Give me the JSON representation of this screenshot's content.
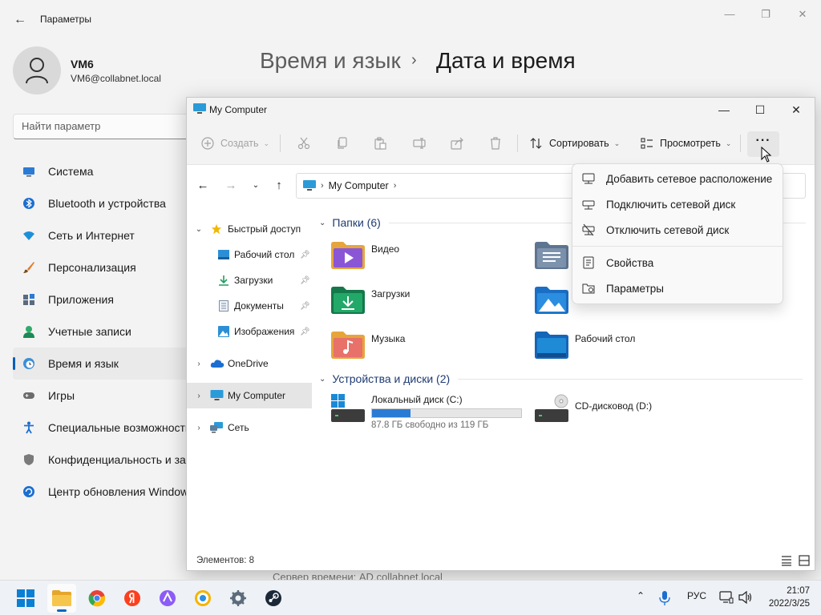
{
  "settings": {
    "window_title": "Параметры",
    "user_name": "VM6",
    "user_email": "VM6@collabnet.local",
    "search_placeholder": "Найти параметр",
    "breadcrumb_parent": "Время и язык",
    "breadcrumb_separator": "›",
    "breadcrumb_current": "Дата и время",
    "bottom_text": "Сервер времени: AD.collabnet.local",
    "nav": [
      {
        "label": "Система",
        "icon": "monitor-icon"
      },
      {
        "label": "Bluetooth и устройства",
        "icon": "bluetooth-icon"
      },
      {
        "label": "Сеть и Интернет",
        "icon": "wifi-icon"
      },
      {
        "label": "Персонализация",
        "icon": "brush-icon"
      },
      {
        "label": "Приложения",
        "icon": "apps-icon"
      },
      {
        "label": "Учетные записи",
        "icon": "person-icon"
      },
      {
        "label": "Время и язык",
        "icon": "globe-clock-icon",
        "active": true
      },
      {
        "label": "Игры",
        "icon": "gamepad-icon"
      },
      {
        "label": "Специальные возможности",
        "icon": "accessibility-icon"
      },
      {
        "label": "Конфиденциальность и защита",
        "icon": "shield-icon"
      },
      {
        "label": "Центр обновления Windows",
        "icon": "update-icon"
      }
    ]
  },
  "explorer": {
    "title": "My Computer",
    "toolbar": {
      "create": "Создать",
      "sort": "Сортировать",
      "view": "Просмотреть",
      "more": "···"
    },
    "address": {
      "location": "My Computer",
      "chevron": "›"
    },
    "tree": [
      {
        "label": "Быстрый доступ",
        "expander": "⌄",
        "icon": "star-icon"
      },
      {
        "label": "Рабочий стол",
        "icon": "desktop-icon",
        "pinned": true
      },
      {
        "label": "Загрузки",
        "icon": "download-icon",
        "pinned": true
      },
      {
        "label": "Документы",
        "icon": "document-icon",
        "pinned": true
      },
      {
        "label": "Изображения",
        "icon": "pictures-icon",
        "pinned": true
      },
      {
        "label": "OneDrive",
        "expander": "›",
        "icon": "cloud-icon"
      },
      {
        "label": "My Computer",
        "expander": "›",
        "icon": "computer-icon",
        "selected": true
      },
      {
        "label": "Сеть",
        "expander": "›",
        "icon": "network-icon"
      }
    ],
    "folders_header": "Папки (6)",
    "folders": [
      {
        "name": "Видео",
        "icon": "video-folder-icon"
      },
      {
        "name": "",
        "icon": "documents-folder-icon"
      },
      {
        "name": "Загрузки",
        "icon": "downloads-folder-icon"
      },
      {
        "name": "",
        "icon": "pictures-folder-icon"
      },
      {
        "name": "Музыка",
        "icon": "music-folder-icon"
      },
      {
        "name": "Рабочий стол",
        "icon": "desktop-folder-icon"
      }
    ],
    "drives_header": "Устройства и диски (2)",
    "drives": [
      {
        "name": "Локальный диск (C:)",
        "free": "87.8 ГБ свободно из 119 ГБ",
        "used_fraction": 0.26
      },
      {
        "name": "CD-дисковод (D:)"
      }
    ],
    "status": "Элементов: 8"
  },
  "menu": {
    "items": [
      {
        "label": "Добавить сетевое расположение",
        "icon": "network-location-icon"
      },
      {
        "label": "Подключить сетевой диск",
        "icon": "map-drive-icon"
      },
      {
        "label": "Отключить сетевой диск",
        "icon": "disconnect-drive-icon"
      },
      {
        "label": "Свойства",
        "icon": "properties-icon"
      },
      {
        "label": "Параметры",
        "icon": "options-icon"
      }
    ]
  },
  "taskbar": {
    "language": "РУС",
    "time": "21:07",
    "date": "2022/3/25"
  },
  "colors": {
    "accent": "#005fb8",
    "folder_yellow": "#f4c04e",
    "drive_fill": "#2a7bd4"
  }
}
